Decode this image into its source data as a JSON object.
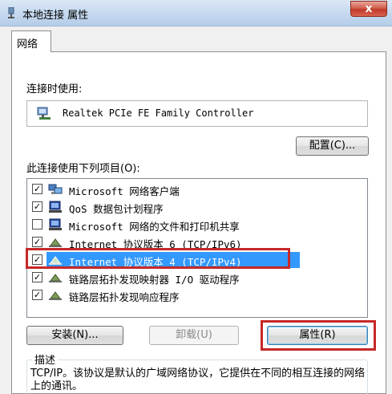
{
  "window": {
    "title": "本地连接 属性",
    "close_label": "x"
  },
  "tabs": [
    {
      "label": "网络"
    }
  ],
  "connect_using": {
    "label": "连接时使用:",
    "adapter_name": "Realtek PCIe FE Family Controller",
    "configure_label": "配置(C)..."
  },
  "items_list": {
    "label": "此连接使用下列项目(O):",
    "items": [
      {
        "label": "Microsoft 网络客户端",
        "checked": true,
        "icon": "network-client-icon"
      },
      {
        "label": "QoS 数据包计划程序",
        "checked": true,
        "icon": "qos-scheduler-icon"
      },
      {
        "label": "Microsoft 网络的文件和打印机共享",
        "checked": false,
        "icon": "file-printer-sharing-icon"
      },
      {
        "label": "Internet 协议版本 6 (TCP/IPv6)",
        "checked": true,
        "icon": "protocol-icon"
      },
      {
        "label": "Internet 协议版本 4 (TCP/IPv4)",
        "checked": true,
        "icon": "protocol-icon",
        "selected": true
      },
      {
        "label": "链路层拓扑发现映射器 I/O 驱动程序",
        "checked": true,
        "icon": "protocol-icon"
      },
      {
        "label": "链路层拓扑发现响应程序",
        "checked": true,
        "icon": "protocol-icon"
      }
    ]
  },
  "buttons": {
    "install": "安装(N)...",
    "uninstall": "卸载(U)",
    "properties": "属性(R)"
  },
  "description": {
    "title": "描述",
    "text": "TCP/IP。该协议是默认的广域网络协议，它提供在不同的相互连接的网络上的通讯。"
  },
  "colors": {
    "selection": "#3399ff",
    "highlight_box": "#c62828"
  }
}
